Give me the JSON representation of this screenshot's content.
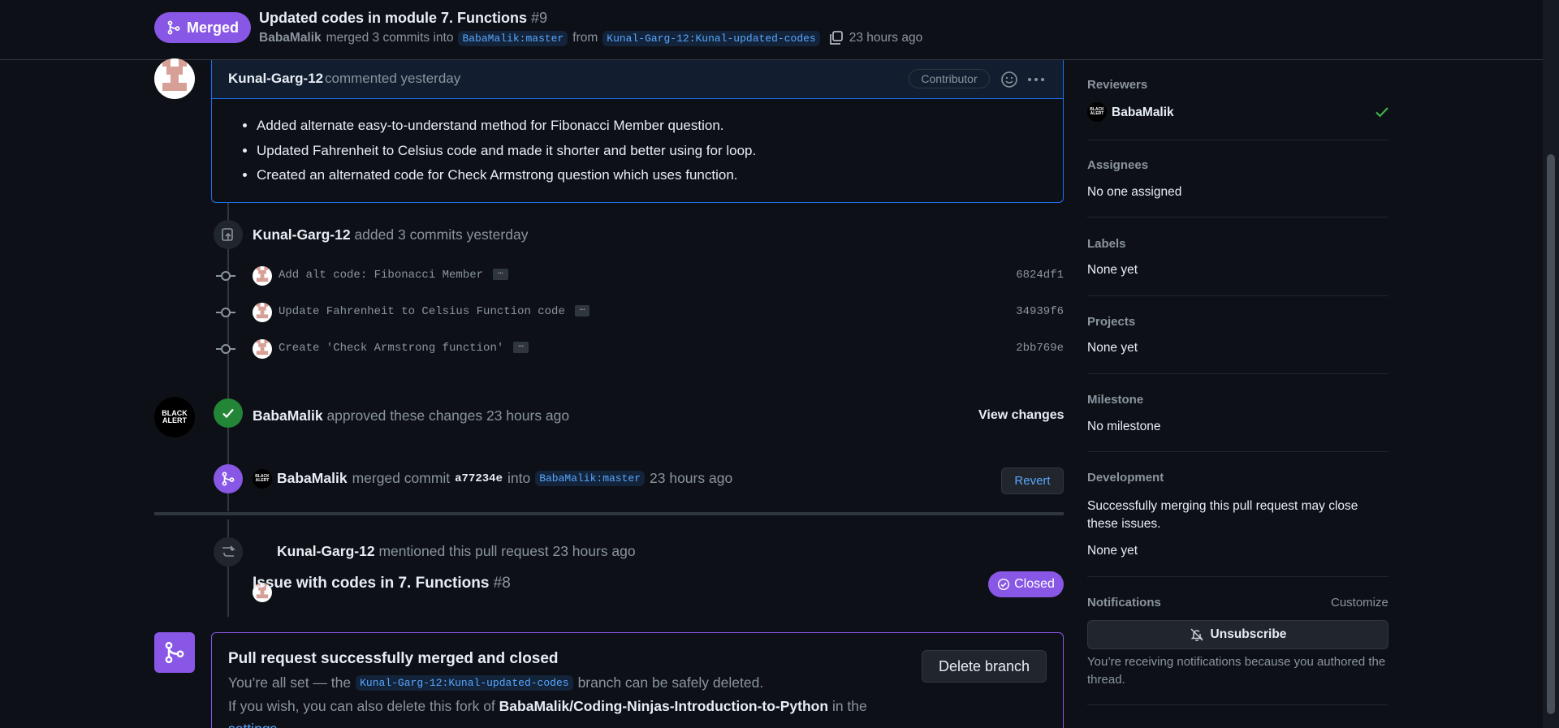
{
  "header": {
    "state": "Merged",
    "title": "Updated codes in module 7. Functions",
    "number": "#9",
    "author": "BabaMalik",
    "merged_text": "merged 3 commits into",
    "base_branch": "BabaMalik:master",
    "from_text": "from",
    "head_branch": "Kunal-Garg-12:Kunal-updated-codes",
    "time": "23 hours ago"
  },
  "comment": {
    "author": "Kunal-Garg-12",
    "verb": "commented yesterday",
    "role": "Contributor",
    "bullets": [
      "Added alternate easy-to-understand method for Fibonacci Member question.",
      "Updated Fahrenheit to Celsius code and made it shorter and better using for loop.",
      "Created an alternated code for Check Armstrong question which uses function."
    ]
  },
  "commits_event": {
    "author": "Kunal-Garg-12",
    "text": "added 3 commits yesterday",
    "commits": [
      {
        "message": "Add alt code: Fibonacci Member",
        "sha": "6824df1"
      },
      {
        "message": "Update Fahrenheit to Celsius Function code",
        "sha": "34939f6"
      },
      {
        "message": "Create 'Check Armstrong function'",
        "sha": "2bb769e"
      }
    ],
    "ellipsis": "…"
  },
  "review": {
    "author": "BabaMalik",
    "text": "approved these changes 23 hours ago",
    "view_changes": "View changes"
  },
  "merge_event": {
    "author": "BabaMalik",
    "text": "merged commit",
    "sha": "a77234e",
    "into": "into",
    "branch": "BabaMalik:master",
    "time": "23 hours ago",
    "revert": "Revert"
  },
  "mention_event": {
    "author": "Kunal-Garg-12",
    "text": "mentioned this pull request 23 hours ago",
    "issue_title": "Issue with codes in 7. Functions",
    "issue_number": "#8",
    "issue_state": "Closed"
  },
  "merge_box": {
    "title": "Pull request successfully merged and closed",
    "line1_prefix": "You’re all set — the",
    "branch": "Kunal-Garg-12:Kunal-updated-codes",
    "line1_suffix": "branch can be safely deleted.",
    "line2_prefix": "If you wish, you can also delete this fork of",
    "repo": "BabaMalik/Coding-Ninjas-Introduction-to-Python",
    "line2_suffix": "in the",
    "settings": "settings",
    "delete_branch": "Delete branch"
  },
  "sidebar": {
    "reviewers_h": "Reviewers",
    "reviewer": "BabaMalik",
    "assignees_h": "Assignees",
    "assignees": "No one assigned",
    "labels_h": "Labels",
    "labels": "None yet",
    "projects_h": "Projects",
    "projects": "None yet",
    "milestone_h": "Milestone",
    "milestone": "No milestone",
    "development_h": "Development",
    "development_text": "Successfully merging this pull request may close these issues.",
    "development": "None yet",
    "notifications_h": "Notifications",
    "customize": "Customize",
    "unsubscribe": "Unsubscribe",
    "notif_text": "You’re receiving notifications because you authored the thread."
  },
  "avatars": {
    "black_alert": "BLACK ALERT"
  },
  "colors": {
    "merged": "#8957e5",
    "approved": "#238636",
    "link": "#58a6ff",
    "bg": "#0d1117"
  }
}
